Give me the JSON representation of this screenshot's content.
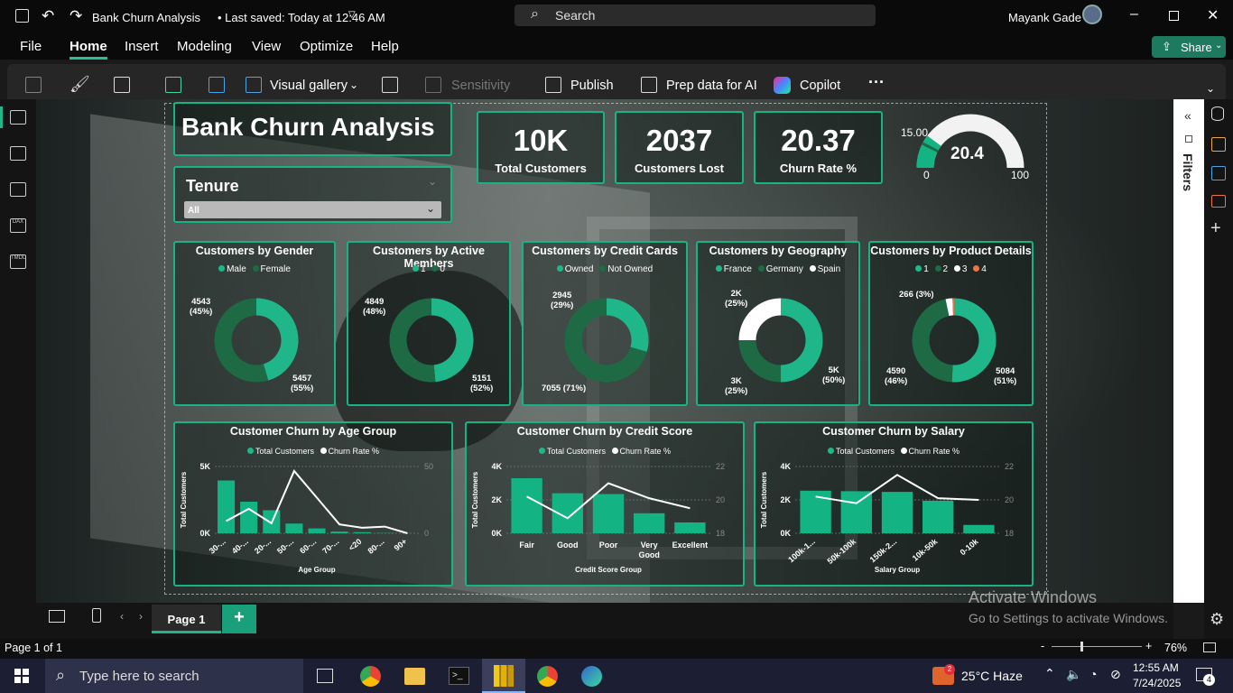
{
  "window": {
    "title": "Bank Churn Analysis",
    "saved": "• Last saved: Today at 12:46 AM",
    "search": "Search",
    "user": "Mayank Gade"
  },
  "menu": [
    "File",
    "Home",
    "Insert",
    "Modeling",
    "View",
    "Optimize",
    "Help"
  ],
  "share": "Share",
  "ribbon": {
    "visual_gallery": "Visual gallery",
    "sensitivity": "Sensitivity",
    "publish": "Publish",
    "prep": "Prep data for AI",
    "copilot": "Copilot",
    "more": "···"
  },
  "colors": {
    "accent": "#1fb789",
    "dark": "#1e6a45",
    "white": "#ffffff",
    "orange": "#e8764a"
  },
  "report": {
    "title": "Bank Churn Analysis",
    "slicer": {
      "title": "Tenure",
      "value": "All"
    }
  },
  "kpis": [
    {
      "value": "10K",
      "label": "Total Customers"
    },
    {
      "value": "2037",
      "label": "Customers Lost"
    },
    {
      "value": "20.37",
      "label": "Churn Rate %"
    }
  ],
  "gauge": {
    "value": "20.4",
    "target": "15.00",
    "min": "0",
    "max": "100",
    "value_num": 20.4,
    "target_num": 15,
    "min_num": 0,
    "max_num": 100
  },
  "donuts": [
    {
      "title": "Customers by Gender",
      "legend": [
        "Male",
        "Female"
      ],
      "values": [
        4543,
        5457
      ],
      "labels": [
        "4543\n(45%)",
        "5457\n(55%)"
      ]
    },
    {
      "title": "Customers by Active Members",
      "legend": [
        "1",
        "0"
      ],
      "values": [
        4849,
        5151
      ],
      "labels": [
        "4849\n(48%)",
        "5151\n(52%)"
      ]
    },
    {
      "title": "Customers by Credit Cards",
      "legend": [
        "Owned",
        "Not Owned"
      ],
      "values": [
        2945,
        7055
      ],
      "labels": [
        "2945\n(29%)",
        "7055 (71%)"
      ]
    },
    {
      "title": "Customers by Geography",
      "legend": [
        "France",
        "Germany",
        "Spain"
      ],
      "values": [
        5000,
        2500,
        2500
      ],
      "labels": [
        "2K\n(25%)",
        "5K\n(50%)",
        "3K\n(25%)"
      ]
    },
    {
      "title": "Customers by Product Details",
      "legend": [
        "1",
        "2",
        "3",
        "4"
      ],
      "values": [
        5084,
        4590,
        266,
        60
      ],
      "labels": [
        "266 (3%)",
        "4590\n(46%)",
        "5084\n(51%)"
      ]
    }
  ],
  "chart_data": [
    {
      "type": "bar",
      "title": "Customer Churn by Age Group",
      "legend": [
        "Total Customers",
        "Churn Rate %"
      ],
      "categories": [
        "30-...",
        "40-...",
        "20-...",
        "50-...",
        "60-...",
        "70-...",
        "<20",
        "80-...",
        "90+"
      ],
      "series": [
        {
          "name": "Total Customers",
          "values": [
            4350,
            2600,
            1900,
            800,
            400,
            140,
            90,
            20,
            2
          ]
        },
        {
          "name": "Churn Rate %",
          "values": [
            11,
            22,
            9,
            56,
            32,
            8,
            5,
            6,
            0
          ]
        }
      ],
      "xlabel": "Age Group",
      "ylabel": "Total Customers",
      "yticks": [
        "0K",
        "5K"
      ],
      "y2ticks": [
        "0",
        "50"
      ],
      "ylim": [
        0,
        5500
      ],
      "y2lim": [
        0,
        60
      ]
    },
    {
      "type": "bar",
      "title": "Customer Churn by Credit Score",
      "legend": [
        "Total Customers",
        "Churn Rate %"
      ],
      "categories": [
        "Fair",
        "Good",
        "Poor",
        "Very\nGood",
        "Excellent"
      ],
      "series": [
        {
          "name": "Total Customers",
          "values": [
            3300,
            2400,
            2350,
            1200,
            650
          ]
        },
        {
          "name": "Churn Rate %",
          "values": [
            20.2,
            18.9,
            21.0,
            20.1,
            19.5
          ]
        }
      ],
      "xlabel": "Credit Score Group",
      "ylabel": "Total Customers",
      "yticks": [
        "0K",
        "2K",
        "4K"
      ],
      "y2ticks": [
        "18",
        "20",
        "22"
      ],
      "ylim": [
        0,
        4000
      ],
      "y2lim": [
        18,
        22
      ]
    },
    {
      "type": "bar",
      "title": "Customer Churn by Salary",
      "legend": [
        "Total Customers",
        "Churn Rate %"
      ],
      "categories": [
        "100k-1...",
        "50k-100k",
        "150k-2...",
        "10k-50k",
        "0-10k"
      ],
      "series": [
        {
          "name": "Total Customers",
          "values": [
            2550,
            2520,
            2480,
            1950,
            500
          ]
        },
        {
          "name": "Churn Rate %",
          "values": [
            20.2,
            19.8,
            21.5,
            20.1,
            20.0
          ]
        }
      ],
      "xlabel": "Salary Group",
      "ylabel": "Total Customers",
      "yticks": [
        "0K",
        "2K",
        "4K"
      ],
      "y2ticks": [
        "18",
        "20",
        "22"
      ],
      "ylim": [
        0,
        4000
      ],
      "y2lim": [
        18,
        22
      ]
    }
  ],
  "filters": "Filters",
  "pages": {
    "tab": "Page 1",
    "add": "+"
  },
  "status": {
    "page": "Page 1 of 1",
    "zoom": "76%",
    "zoom_minus": "-",
    "zoom_plus": "+"
  },
  "watermark": {
    "line1": "Activate Windows",
    "line2": "Go to Settings to activate Windows."
  },
  "taskbar": {
    "search": "Type here to search",
    "weather": "25°C  Haze",
    "time": "12:55 AM",
    "date": "7/24/2025",
    "notif": "4",
    "weather_badge": "2"
  }
}
